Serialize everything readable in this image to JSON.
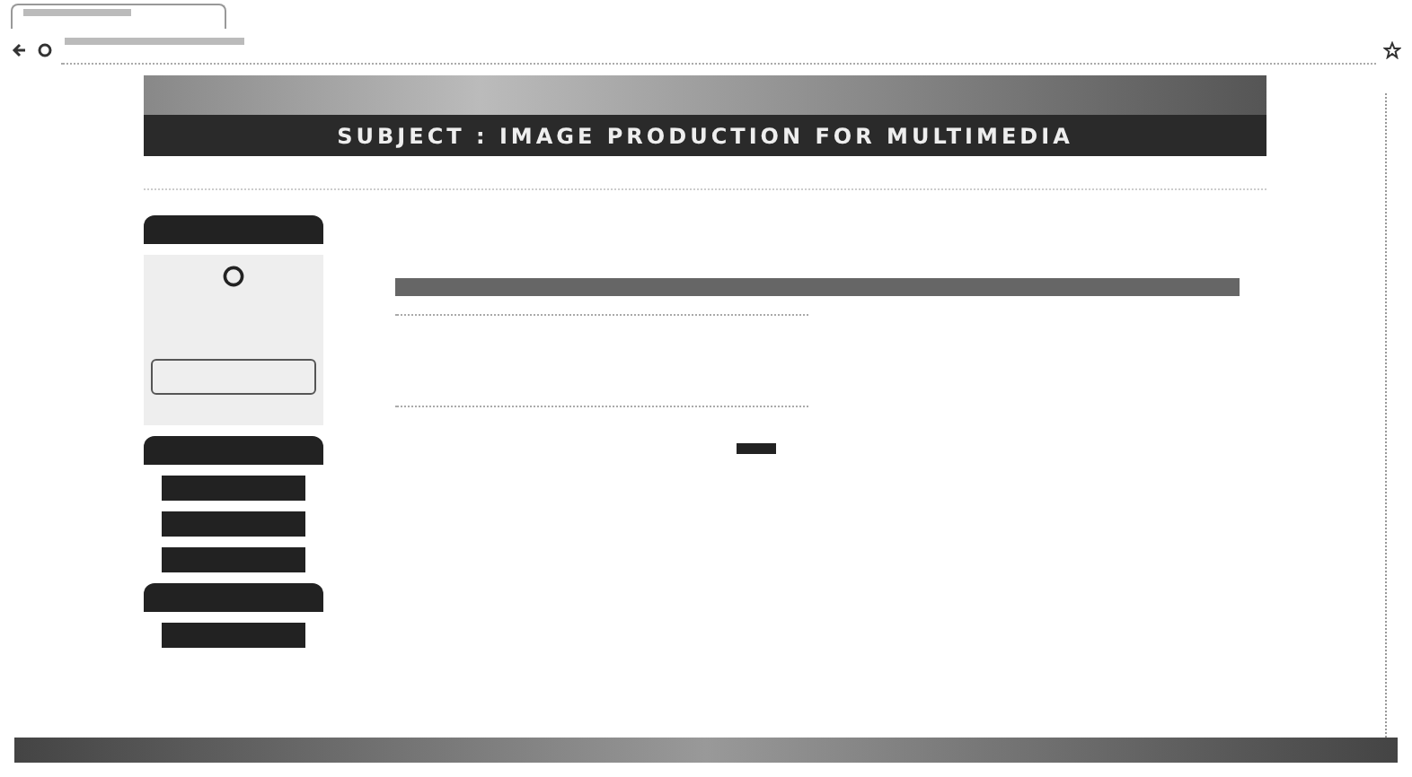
{
  "banner": {
    "subtitle": "SUBJECT : IMAGE PRODUCTION FOR MULTIMEDIA"
  },
  "sidebar": {
    "blocks": [
      {
        "kind": "header"
      },
      {
        "kind": "login"
      },
      {
        "kind": "header"
      },
      {
        "kind": "button"
      },
      {
        "kind": "button"
      },
      {
        "kind": "button"
      },
      {
        "kind": "header"
      },
      {
        "kind": "button"
      }
    ]
  }
}
